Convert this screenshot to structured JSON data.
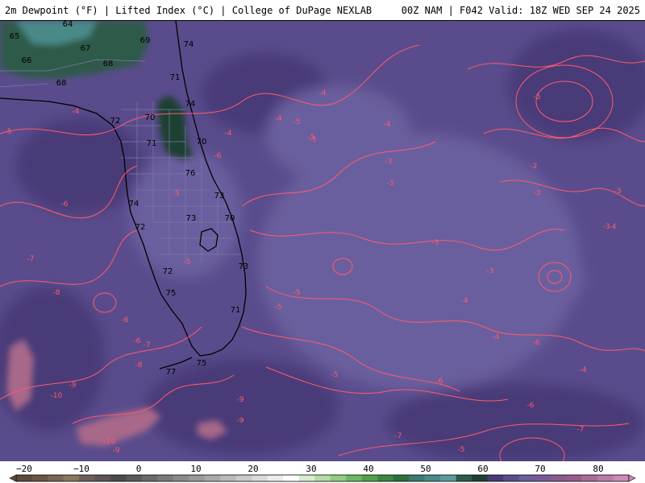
{
  "header": {
    "left_title": "2m Dewpoint (°F) | Lifted Index (°C) | College of DuPage NEXLAB",
    "right_title": "00Z NAM | F042 Valid: 18Z WED SEP 24 2025"
  },
  "colors": {
    "background_field": "#5a4c8c",
    "dark_field": "#483a78",
    "light_field": "#6b5e9e",
    "green_field": "#2e5a4a",
    "dark_green_field": "#1f4033",
    "pink_field": "#a8688a",
    "contour": "#ff5a6e",
    "coastline": "#000000",
    "county_lines": "#7f78a8"
  },
  "dewpoint_labels": [
    "64",
    "65",
    "66",
    "67",
    "68",
    "69",
    "68",
    "74",
    "71",
    "74",
    "72",
    "70",
    "71",
    "70",
    "76",
    "74",
    "73",
    "72",
    "73",
    "70",
    "73",
    "72",
    "75",
    "71",
    "75",
    "77",
    "76"
  ],
  "lifted_index_labels": [
    "-4",
    "-5",
    "-6",
    "-5",
    "-4",
    "-4",
    "-3",
    "-2",
    "-3",
    "-3",
    "-3",
    "-5",
    "-5",
    "-6",
    "-7",
    "-5",
    "-8",
    "-6",
    "-6",
    "-7",
    "-8",
    "-9",
    "-10",
    "-10",
    "-9",
    "-9",
    "-9",
    "-5",
    "-4",
    "-4",
    "-6",
    "-5",
    "-6",
    "-7",
    "-6",
    "-7",
    "-5",
    "-5",
    "-4",
    "-4",
    "-3",
    "-3",
    "-4",
    "-5",
    "-3",
    "-5",
    "-4"
  ],
  "legend": {
    "tick_labels": [
      "−20",
      "−10",
      "0",
      "10",
      "20",
      "30",
      "40",
      "50",
      "60",
      "70",
      "80"
    ],
    "colors": [
      "#5c4a3c",
      "#6b5646",
      "#7a6552",
      "#8a755f",
      "#6e5e58",
      "#5e5454",
      "#4e4a4a",
      "#5a5a5a",
      "#6a6a6a",
      "#7a7a7a",
      "#8a8a8a",
      "#9a9a9a",
      "#aaaaaa",
      "#bababa",
      "#cacaca",
      "#dadada",
      "#ececec",
      "#ffffff",
      "#d8ecd0",
      "#b4dca8",
      "#90cc84",
      "#6cb860",
      "#50a04c",
      "#3a8840",
      "#2c7038",
      "#3a7a70",
      "#4a8a88",
      "#5a9aa0",
      "#2e5a4a",
      "#1f4033",
      "#483a78",
      "#5a4c8c",
      "#6b5e9e",
      "#7a5a96",
      "#8a5a90",
      "#9a5a8c",
      "#aa6a9a",
      "#bb7aaa",
      "#cc8aba"
    ]
  }
}
